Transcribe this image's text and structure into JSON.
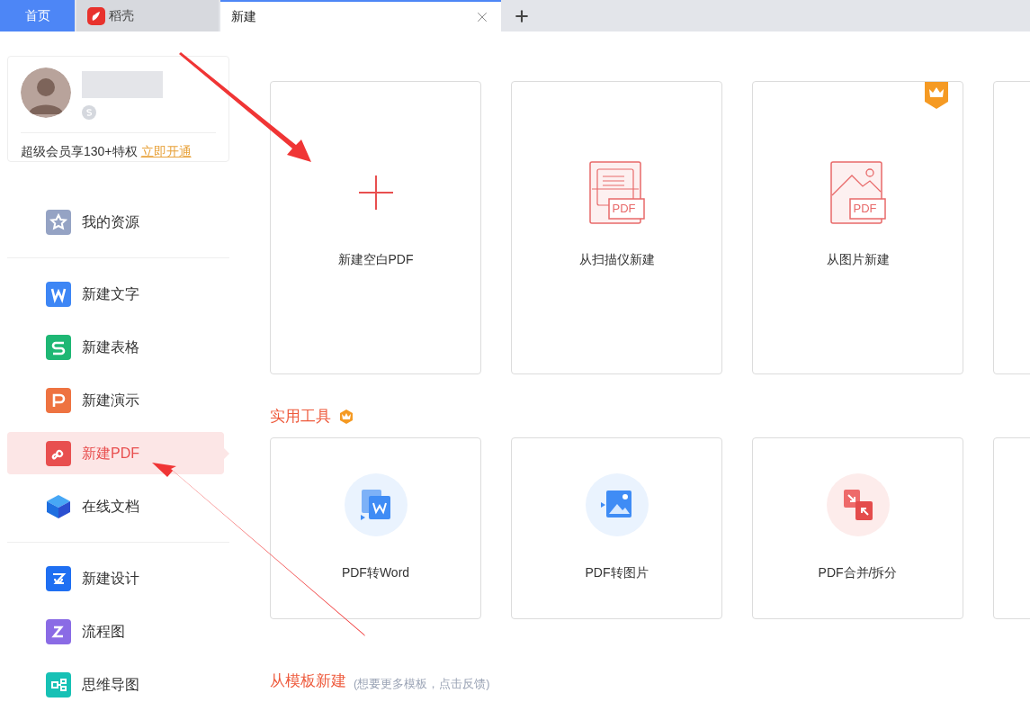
{
  "tabs": [
    {
      "kind": "home",
      "label": "首页",
      "selected": false
    },
    {
      "kind": "docer",
      "label": "稻壳",
      "selected": false
    },
    {
      "kind": "doc",
      "label": "新建",
      "selected": true
    }
  ],
  "profile": {
    "promo": "超级会员享130+特权",
    "link": "立即开通"
  },
  "sidebar": {
    "groups": [
      [
        {
          "kind": "star",
          "label": "我的资源",
          "selected": false
        }
      ],
      [
        {
          "kind": "word",
          "label": "新建文字",
          "selected": false
        },
        {
          "kind": "sheet",
          "label": "新建表格",
          "selected": false
        },
        {
          "kind": "ppt",
          "label": "新建演示",
          "selected": false
        },
        {
          "kind": "pdf",
          "label": "新建PDF",
          "selected": true
        },
        {
          "kind": "cloud",
          "label": "在线文档",
          "selected": false
        }
      ],
      [
        {
          "kind": "design",
          "label": "新建设计",
          "selected": false
        },
        {
          "kind": "flow",
          "label": "流程图",
          "selected": false
        },
        {
          "kind": "mind",
          "label": "思维导图",
          "selected": false
        }
      ]
    ]
  },
  "create_cards": [
    {
      "kind": "plus",
      "label": "新建空白PDF",
      "vip": false
    },
    {
      "kind": "scan",
      "tag": "PDF",
      "label": "从扫描仪新建",
      "vip": false
    },
    {
      "kind": "image",
      "tag": "PDF",
      "label": "从图片新建",
      "vip": true
    }
  ],
  "tools": {
    "title": "实用工具",
    "vip": true,
    "cards": [
      {
        "kind": "toword",
        "label": "PDF转Word"
      },
      {
        "kind": "toimage",
        "label": "PDF转图片"
      },
      {
        "kind": "merge",
        "label": "PDF合并/拆分"
      }
    ]
  },
  "templates": {
    "title": "从模板新建",
    "hint": "(想要更多模板，点击反馈)"
  }
}
